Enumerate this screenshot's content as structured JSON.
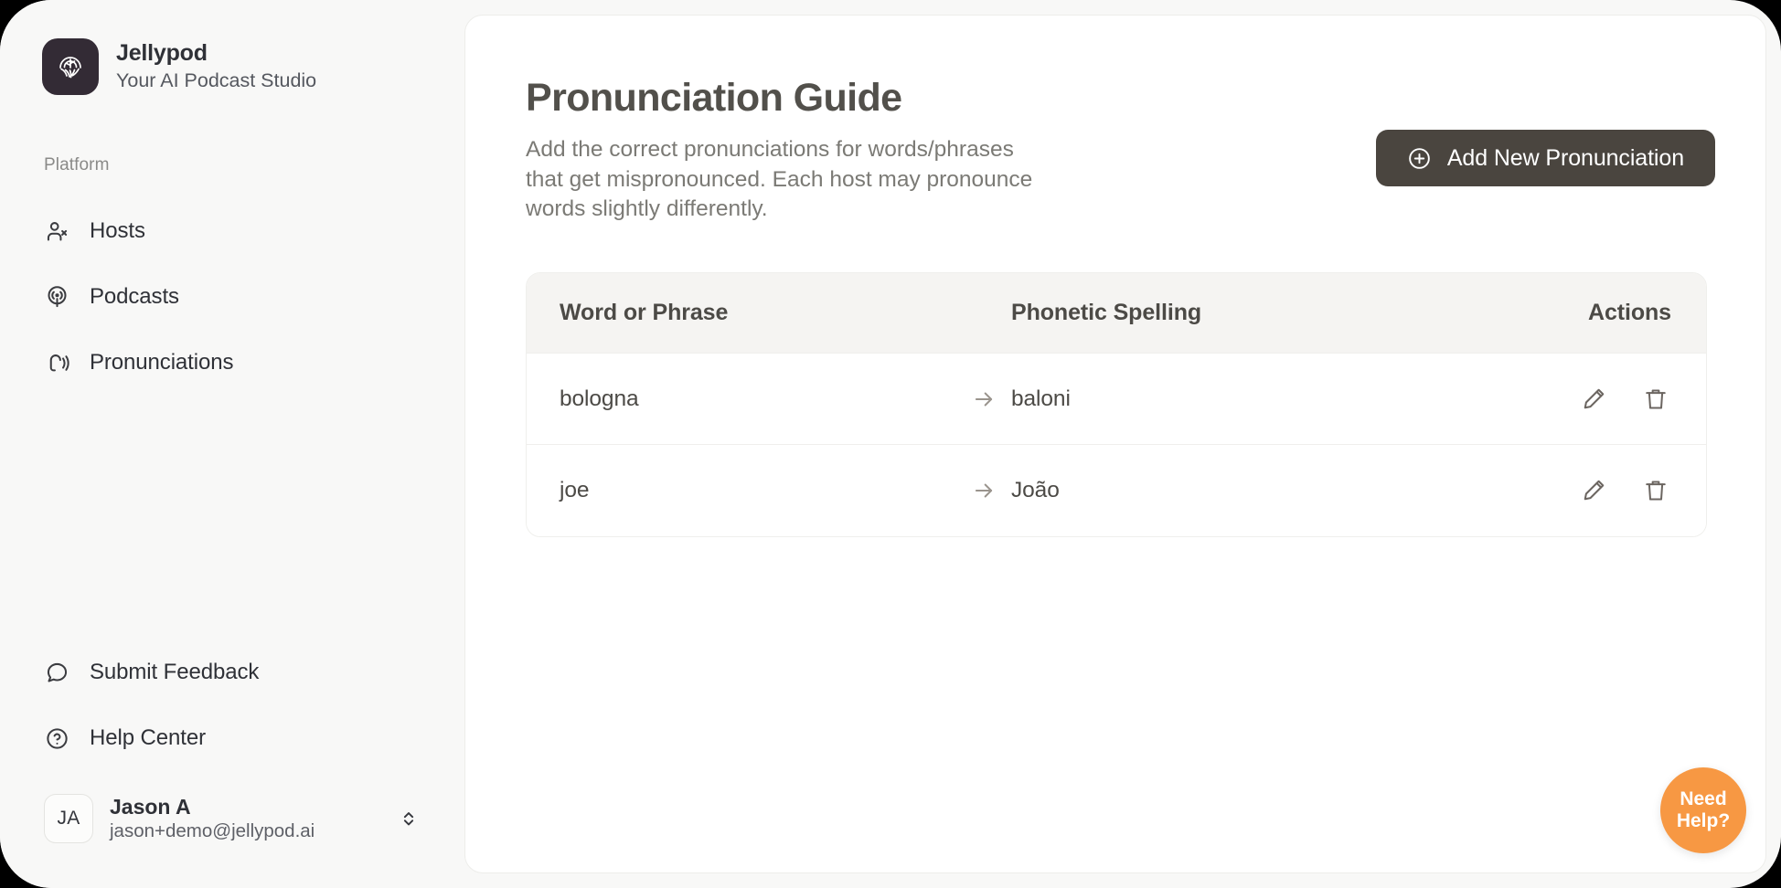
{
  "brand": {
    "name": "Jellypod",
    "tagline": "Your AI Podcast Studio",
    "logo_icon": "jellyfish-icon",
    "logo_bg": "#332B35"
  },
  "sidebar": {
    "section_label": "Platform",
    "items": [
      {
        "label": "Hosts",
        "icon": "users-icon"
      },
      {
        "label": "Podcasts",
        "icon": "podcast-icon"
      },
      {
        "label": "Pronunciations",
        "icon": "speech-waves-icon"
      }
    ],
    "bottom_items": [
      {
        "label": "Submit Feedback",
        "icon": "message-circle-icon"
      },
      {
        "label": "Help Center",
        "icon": "question-circle-icon"
      }
    ],
    "user": {
      "initials": "JA",
      "name": "Jason A",
      "email": "jason+demo@jellypod.ai",
      "chevrons_icon": "chevron-up-down-icon"
    }
  },
  "main": {
    "title": "Pronunciation Guide",
    "description": "Add the correct pronunciations for words/phrases that get mispronounced. Each host may pronounce words slightly differently.",
    "add_button": {
      "label": "Add New Pronunciation",
      "icon": "plus-circle-icon",
      "bg": "#4A453F"
    },
    "table": {
      "columns": [
        "Word or Phrase",
        "Phonetic Spelling",
        "Actions"
      ],
      "rows": [
        {
          "word": "bologna",
          "phonetic": "baloni",
          "arrow": "arrow-right-icon",
          "edit": "pencil-icon",
          "delete": "trash-icon"
        },
        {
          "word": "joe",
          "phonetic": "João",
          "arrow": "arrow-right-icon",
          "edit": "pencil-icon",
          "delete": "trash-icon"
        }
      ]
    }
  },
  "help_widget": {
    "line1": "Need",
    "line2": "Help?",
    "color": "#F79843"
  }
}
